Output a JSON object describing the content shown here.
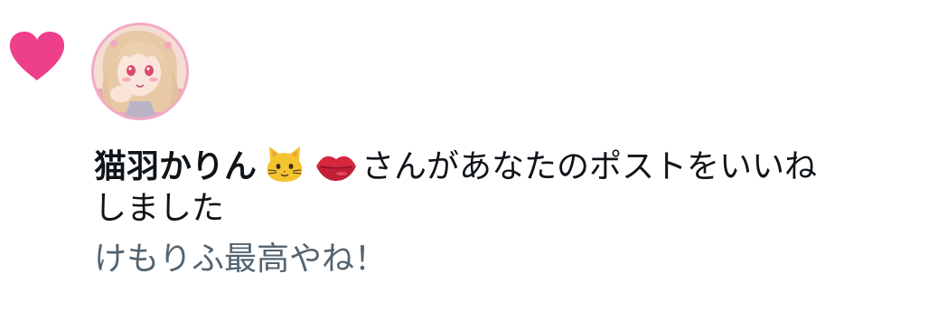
{
  "notification": {
    "type_icon": "heart-icon",
    "icon_color": "#f91880",
    "avatar": "user-avatar",
    "user_name": "猫羽かりん",
    "name_emojis": [
      "cat-face-emoji",
      "lips-emoji"
    ],
    "action_line_1": "さんがあなたのポストをいいね",
    "action_line_2": "しました",
    "post_text": "けもりふ最高やね！"
  },
  "colors": {
    "primary_text": "#0f1419",
    "secondary_text": "#536471",
    "like_pink": "#f91880"
  }
}
